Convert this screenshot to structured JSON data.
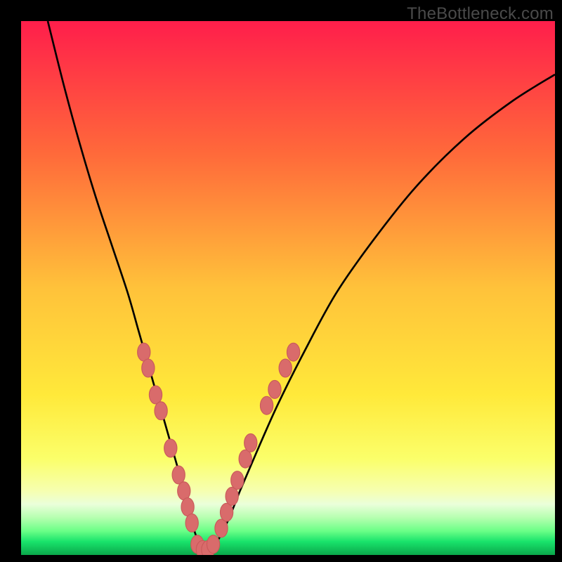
{
  "watermark": "TheBottleneck.com",
  "colors": {
    "frame": "#000000",
    "curve_stroke": "#000000",
    "marker_fill": "#d96b6b",
    "marker_stroke": "#c95a5a",
    "gradient_stops": [
      {
        "offset": 0,
        "color": "#ff1e4b"
      },
      {
        "offset": 0.25,
        "color": "#ff6a3a"
      },
      {
        "offset": 0.5,
        "color": "#ffc23a"
      },
      {
        "offset": 0.7,
        "color": "#ffe93a"
      },
      {
        "offset": 0.82,
        "color": "#fbff6a"
      },
      {
        "offset": 0.88,
        "color": "#f6ffb0"
      },
      {
        "offset": 0.905,
        "color": "#eaffda"
      },
      {
        "offset": 0.93,
        "color": "#b6ffb0"
      },
      {
        "offset": 0.955,
        "color": "#6bff87"
      },
      {
        "offset": 0.975,
        "color": "#19e36b"
      },
      {
        "offset": 1.0,
        "color": "#0aa74a"
      }
    ]
  },
  "chart_data": {
    "type": "line",
    "title": "",
    "xlabel": "",
    "ylabel": "",
    "xlim": [
      0,
      100
    ],
    "ylim": [
      0,
      100
    ],
    "grid": false,
    "legend": false,
    "series": [
      {
        "name": "bottleneck-curve",
        "x": [
          5,
          8,
          11,
          14,
          17,
          20,
          22,
          24,
          26,
          28,
          30,
          31,
          32,
          33,
          34,
          35,
          37,
          39,
          41,
          44,
          48,
          53,
          59,
          66,
          74,
          83,
          92,
          100
        ],
        "y": [
          100,
          88,
          77,
          67,
          58,
          49,
          42,
          35,
          28,
          21,
          14,
          10,
          6,
          3,
          1,
          1,
          3,
          7,
          12,
          19,
          28,
          38,
          49,
          59,
          69,
          78,
          85,
          90
        ]
      }
    ],
    "markers": [
      {
        "series": "left-branch",
        "x": 23.0,
        "y": 38.0
      },
      {
        "series": "left-branch",
        "x": 23.8,
        "y": 35.0
      },
      {
        "series": "left-branch",
        "x": 25.2,
        "y": 30.0
      },
      {
        "series": "left-branch",
        "x": 26.2,
        "y": 27.0
      },
      {
        "series": "left-branch",
        "x": 28.0,
        "y": 20.0
      },
      {
        "series": "left-branch",
        "x": 29.5,
        "y": 15.0
      },
      {
        "series": "left-branch",
        "x": 30.5,
        "y": 12.0
      },
      {
        "series": "left-branch",
        "x": 31.2,
        "y": 9.0
      },
      {
        "series": "left-branch",
        "x": 32.0,
        "y": 6.0
      },
      {
        "series": "bottom",
        "x": 33.0,
        "y": 2.0
      },
      {
        "series": "bottom",
        "x": 34.0,
        "y": 1.0
      },
      {
        "series": "bottom",
        "x": 35.0,
        "y": 1.0
      },
      {
        "series": "bottom",
        "x": 36.0,
        "y": 2.0
      },
      {
        "series": "right-branch",
        "x": 37.5,
        "y": 5.0
      },
      {
        "series": "right-branch",
        "x": 38.5,
        "y": 8.0
      },
      {
        "series": "right-branch",
        "x": 39.5,
        "y": 11.0
      },
      {
        "series": "right-branch",
        "x": 40.5,
        "y": 14.0
      },
      {
        "series": "right-branch",
        "x": 42.0,
        "y": 18.0
      },
      {
        "series": "right-branch",
        "x": 43.0,
        "y": 21.0
      },
      {
        "series": "right-branch",
        "x": 46.0,
        "y": 28.0
      },
      {
        "series": "right-branch",
        "x": 47.5,
        "y": 31.0
      },
      {
        "series": "right-branch",
        "x": 49.5,
        "y": 35.0
      },
      {
        "series": "right-branch",
        "x": 51.0,
        "y": 38.0
      }
    ]
  }
}
